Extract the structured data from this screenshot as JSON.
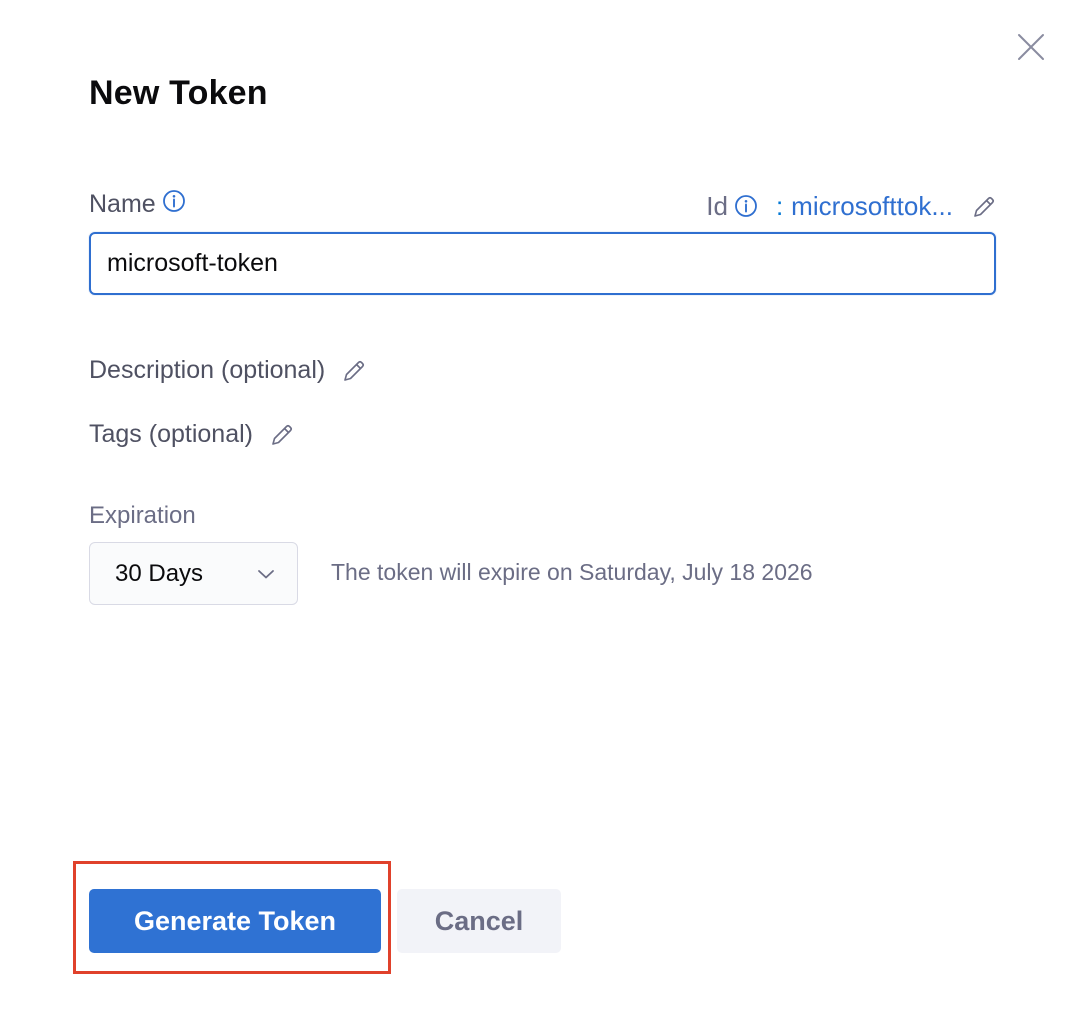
{
  "dialog": {
    "title": "New Token",
    "close_icon": "close-icon"
  },
  "name_field": {
    "label": "Name",
    "value": "microsoft-token",
    "info_icon": "info-icon"
  },
  "id_field": {
    "label": "Id",
    "separator": ":",
    "value": "microsofttok...",
    "info_icon": "info-icon",
    "edit_icon": "pencil-icon"
  },
  "description": {
    "label": "Description (optional)",
    "edit_icon": "pencil-icon"
  },
  "tags": {
    "label": "Tags (optional)",
    "edit_icon": "pencil-icon"
  },
  "expiration": {
    "label": "Expiration",
    "selected": "30 Days",
    "note": "The token will expire on Saturday, July 18 2026",
    "chevron_icon": "chevron-down-icon"
  },
  "actions": {
    "primary_label": "Generate Token",
    "secondary_label": "Cancel"
  },
  "colors": {
    "accent": "#2f72d3",
    "link": "#2f6fd0",
    "highlight": "#e0412b",
    "muted_text": "#6b6d85"
  }
}
